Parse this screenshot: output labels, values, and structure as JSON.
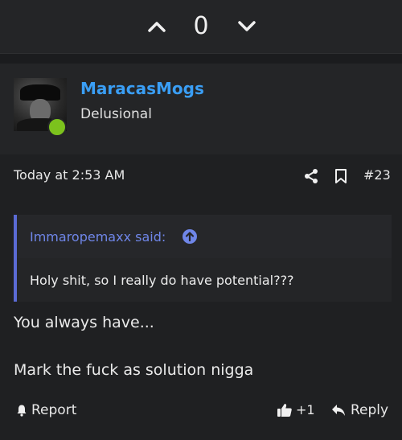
{
  "vote": {
    "count": "0"
  },
  "post": {
    "username": "MaracasMogs",
    "user_title": "Delusional",
    "timestamp": "Today at 2:53 AM",
    "post_number": "#23",
    "quote": {
      "author": "Immaropemaxx said:",
      "text": "Holy shit, so I really do have potential???"
    },
    "body": {
      "line1": "You always have...",
      "line2": "Mark the fuck as solution nigga"
    },
    "actions": {
      "report": "Report",
      "like_count": "+1",
      "reply": "Reply"
    }
  },
  "colors": {
    "accent": "#3a9ef5",
    "quote_accent": "#5b6bd5",
    "online": "#7cc21d"
  }
}
